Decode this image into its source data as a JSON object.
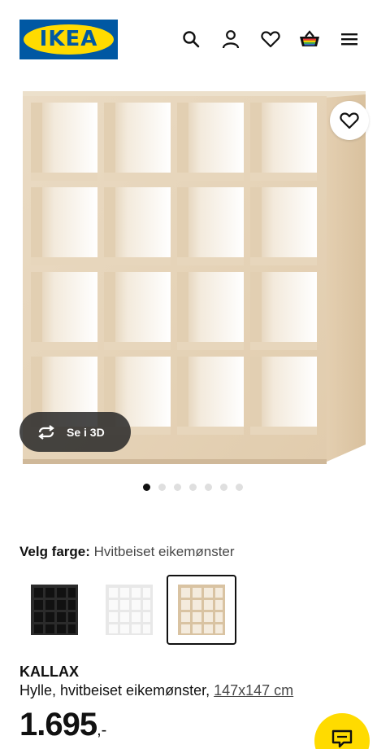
{
  "header": {
    "logo_text": "IKEA",
    "icons": [
      "search-icon",
      "user-icon",
      "heart-icon",
      "basket-icon",
      "menu-icon"
    ]
  },
  "gallery": {
    "view_3d_label": "Se i 3D",
    "dot_count": 7,
    "active_dot": 0
  },
  "color": {
    "label": "Velg farge:",
    "value": "Hvitbeiset eikemønster",
    "swatches": [
      "black-brown",
      "white",
      "white-stained-oak"
    ],
    "selected": 2
  },
  "product": {
    "name": "KALLAX",
    "description": "Hylle, hvitbeiset eikemønster,",
    "size": "147x147 cm",
    "price_main": "1.695",
    "price_decimal": ",-"
  },
  "colors": {
    "brand_blue": "#0058a3",
    "brand_yellow": "#ffdb00",
    "wood": "#e6d3b8"
  }
}
